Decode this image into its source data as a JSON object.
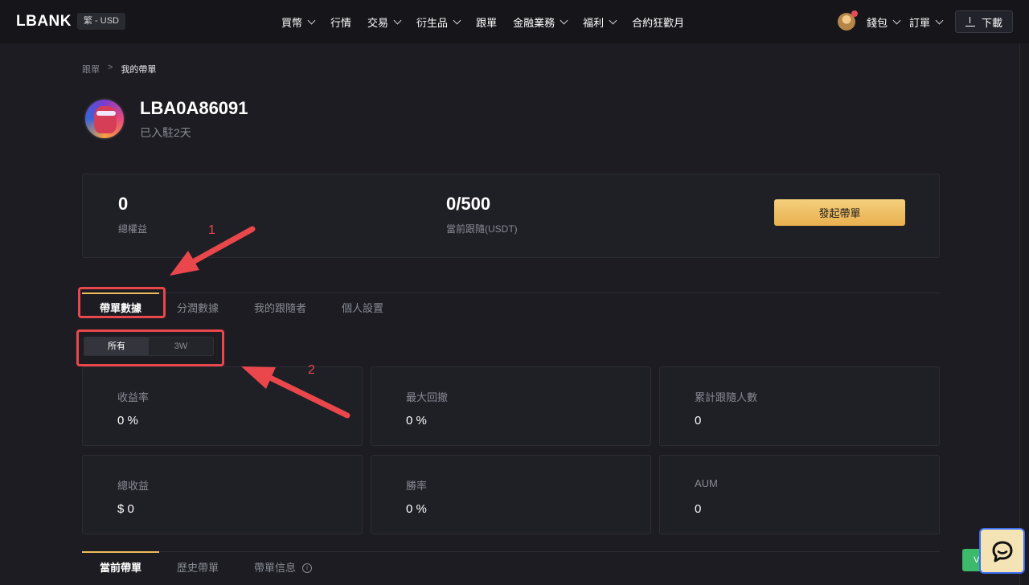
{
  "nav": {
    "logo": "LBANK",
    "lang_currency": "繁 - USD",
    "menu": [
      {
        "label": "買幣",
        "dropdown": true
      },
      {
        "label": "行情",
        "dropdown": false
      },
      {
        "label": "交易",
        "dropdown": true
      },
      {
        "label": "衍生品",
        "dropdown": true
      },
      {
        "label": "跟單",
        "dropdown": false
      },
      {
        "label": "金融業務",
        "dropdown": true
      },
      {
        "label": "福利",
        "dropdown": true
      },
      {
        "label": "合約狂歡月",
        "dropdown": false
      }
    ],
    "wallet": "錢包",
    "orders": "訂單",
    "download": "下載"
  },
  "breadcrumb": {
    "parent": "跟單",
    "separator": ">",
    "current": "我的帶單"
  },
  "profile": {
    "name": "LBA0A86091",
    "joined": "已入駐2天"
  },
  "stats": {
    "total_equity_value": "0",
    "total_equity_label": "總權益",
    "followers_value": "0/500",
    "followers_label": "當前跟隨(USDT)",
    "start_button": "發起帶單"
  },
  "tabs": [
    {
      "label": "帶單數據",
      "active": true
    },
    {
      "label": "分潤數據",
      "active": false
    },
    {
      "label": "我的跟隨者",
      "active": false
    },
    {
      "label": "個人設置",
      "active": false
    }
  ],
  "filter": {
    "options": [
      {
        "label": "所有",
        "active": true
      },
      {
        "label": "3W",
        "active": false
      }
    ]
  },
  "metrics": [
    {
      "label": "收益率",
      "value": "0 %"
    },
    {
      "label": "最大回撤",
      "value": "0 %"
    },
    {
      "label": "累計跟隨人數",
      "value": "0"
    },
    {
      "label": "總收益",
      "value": "$ 0"
    },
    {
      "label": "勝率",
      "value": "0 %"
    },
    {
      "label": "AUM",
      "value": "0"
    }
  ],
  "bottom_tabs": [
    {
      "label": "當前帶單",
      "active": true
    },
    {
      "label": "歷史帶單",
      "active": false
    },
    {
      "label": "帶單信息",
      "active": false,
      "info": true
    }
  ],
  "annotations": {
    "num1": "1",
    "num2": "2",
    "color": "#e9474b"
  },
  "green_chip": "V",
  "colors": {
    "accent": "#efbd5b",
    "background": "#1c1c22",
    "card": "#1f1f26"
  }
}
